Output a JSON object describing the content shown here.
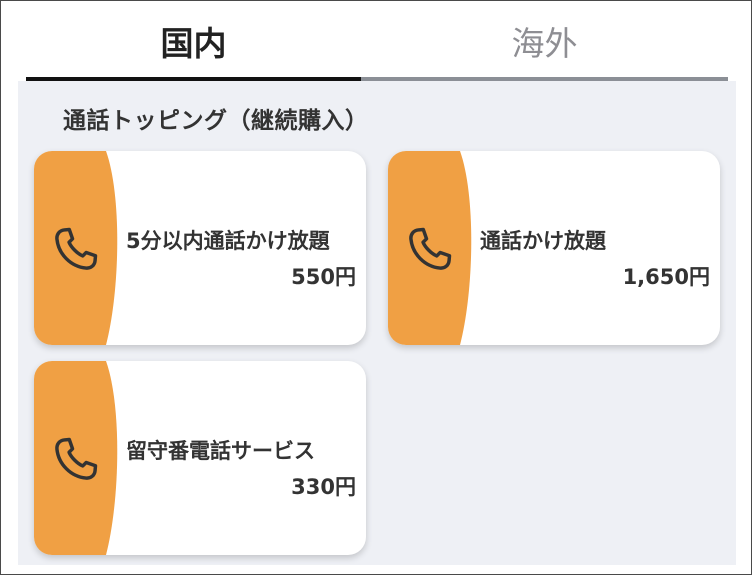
{
  "tabs": [
    {
      "label": "国内",
      "active": true
    },
    {
      "label": "海外",
      "active": false
    }
  ],
  "section": {
    "title": "通話トッピング（継続購入）"
  },
  "cards": [
    {
      "name": "5分以内通話かけ放題",
      "price": "550円",
      "icon": "phone-icon"
    },
    {
      "name": "通話かけ放題",
      "price": "1,650円",
      "icon": "phone-icon"
    },
    {
      "name": "留守番電話サービス",
      "price": "330円",
      "icon": "phone-icon"
    }
  ],
  "colors": {
    "accent": "#f0a044",
    "active_tab_underline": "#111111",
    "inactive_tab_underline": "#8b8f96",
    "background": "#eef0f5"
  }
}
